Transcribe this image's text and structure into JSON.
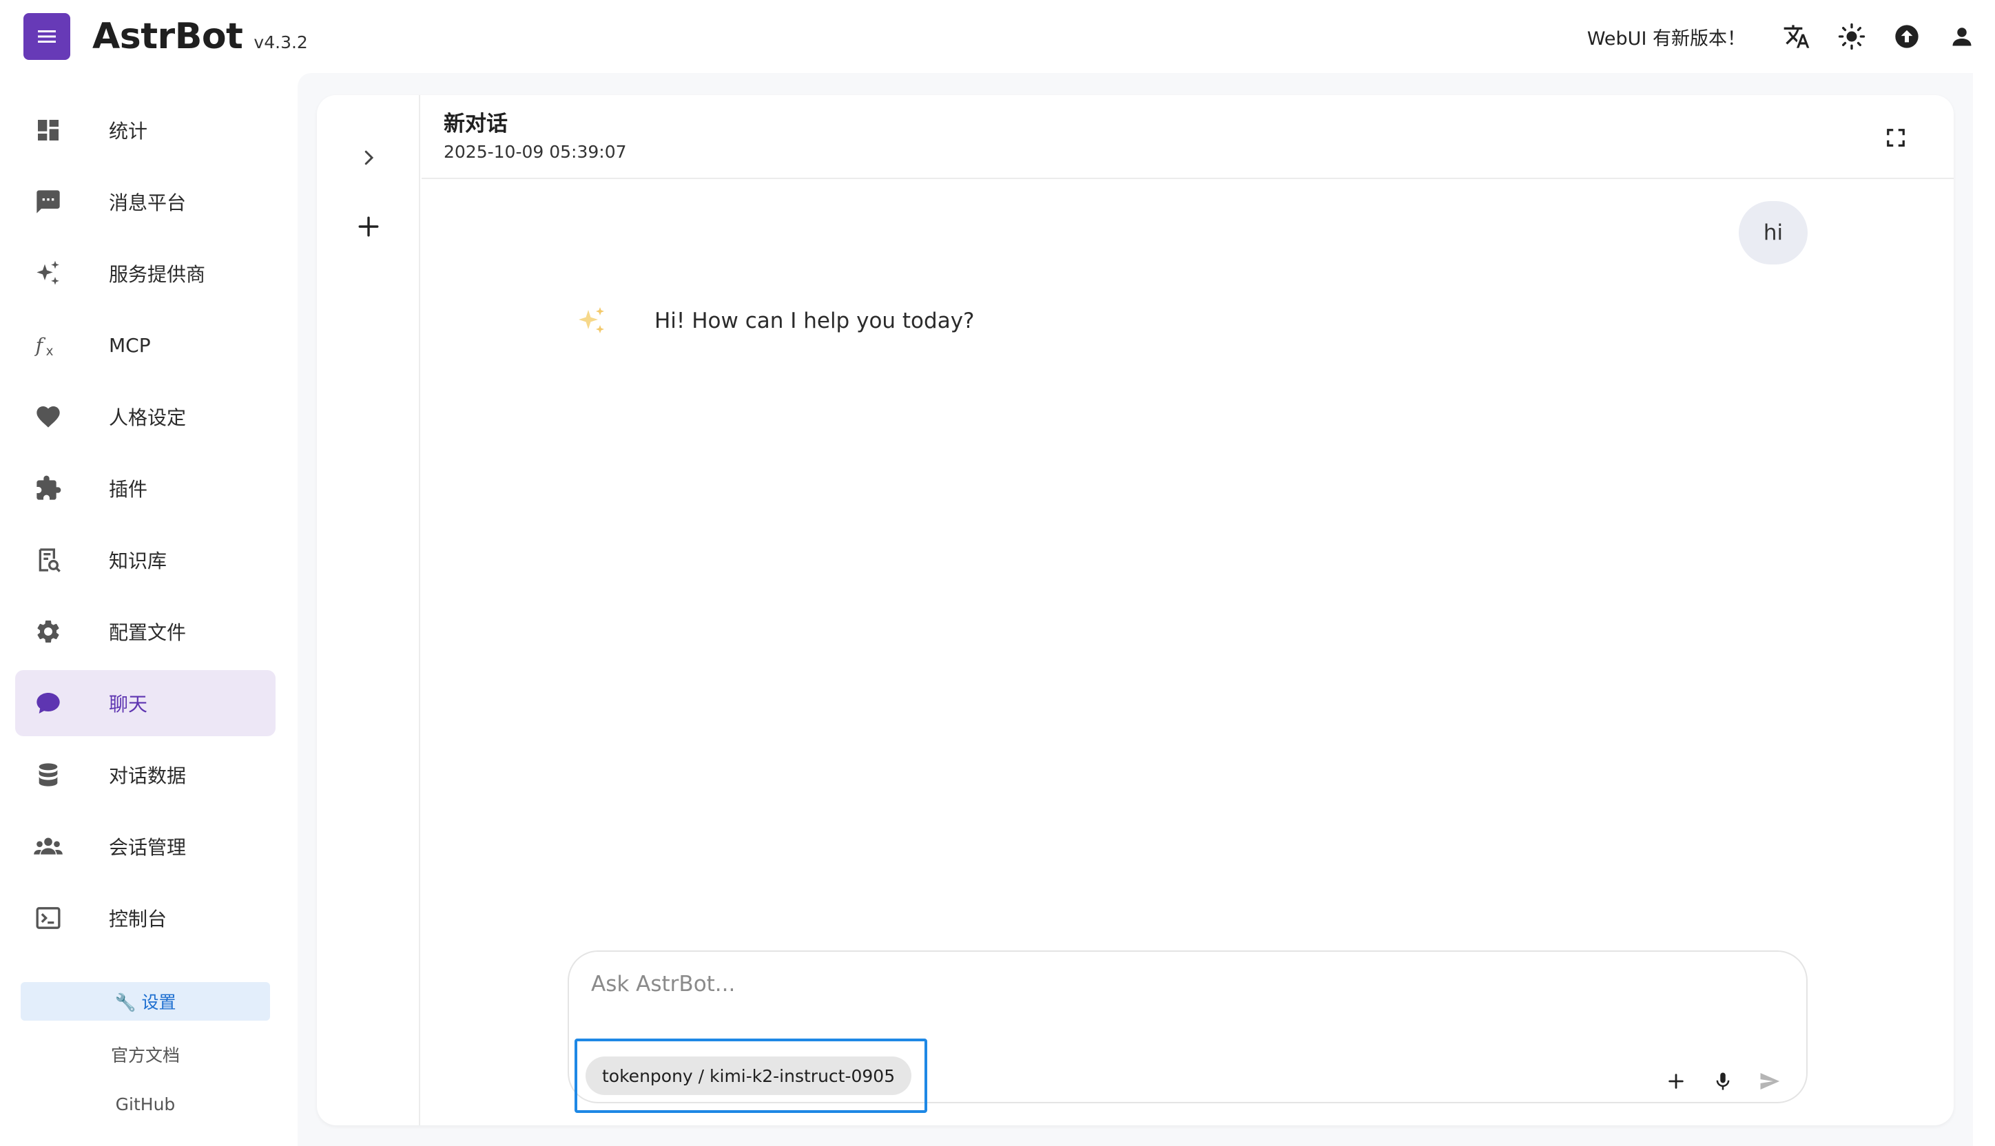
{
  "app": {
    "name": "AstrBot",
    "version": "v4.3.2",
    "update_notice": "WebUI 有新版本！",
    "accent": "#673ab7"
  },
  "sidebar": {
    "items": [
      {
        "label": "统计",
        "icon": "dashboard-icon"
      },
      {
        "label": "消息平台",
        "icon": "message-icon"
      },
      {
        "label": "服务提供商",
        "icon": "sparkles-icon"
      },
      {
        "label": "MCP",
        "icon": "function-icon"
      },
      {
        "label": "人格设定",
        "icon": "heart-icon"
      },
      {
        "label": "插件",
        "icon": "puzzle-icon"
      },
      {
        "label": "知识库",
        "icon": "book-search-icon"
      },
      {
        "label": "配置文件",
        "icon": "gear-icon"
      },
      {
        "label": "聊天",
        "icon": "chat-icon",
        "active": true
      },
      {
        "label": "对话数据",
        "icon": "database-icon"
      },
      {
        "label": "会话管理",
        "icon": "people-icon"
      },
      {
        "label": "控制台",
        "icon": "terminal-icon"
      }
    ],
    "settings_label": "🔧 设置",
    "docs_label": "官方文档",
    "github_label": "GitHub"
  },
  "chat": {
    "title": "新对话",
    "timestamp": "2025-10-09 05:39:07",
    "messages": [
      {
        "role": "user",
        "text": "hi"
      },
      {
        "role": "assistant",
        "text": "Hi! How can I help you today?"
      }
    ],
    "input_placeholder": "Ask AstrBot...",
    "input_value": "",
    "model": "tokenpony / kimi-k2-instruct-0905"
  }
}
